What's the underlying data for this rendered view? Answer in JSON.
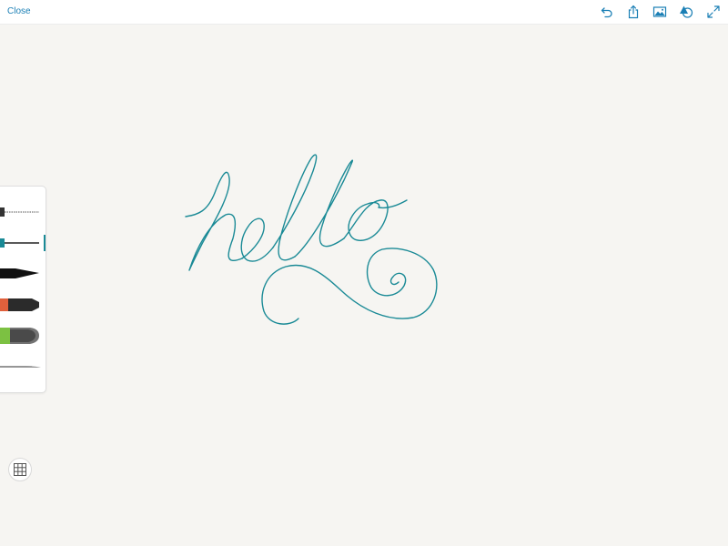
{
  "topbar": {
    "close_label": "Close",
    "tools": [
      {
        "icon": "undo-icon"
      },
      {
        "icon": "share-icon"
      },
      {
        "icon": "image-icon"
      },
      {
        "icon": "layers-icon"
      },
      {
        "icon": "fullscreen-icon"
      }
    ]
  },
  "canvas": {
    "ink_color": "#1a8a96",
    "drawing_text": "hello"
  },
  "brush_panel": {
    "brushes": [
      {
        "name": "fine-pen"
      },
      {
        "name": "line-pen",
        "selected": true
      },
      {
        "name": "calligraphy-pen"
      },
      {
        "name": "marker",
        "color": "#e0603c"
      },
      {
        "name": "watercolor",
        "color": "#7cc142"
      },
      {
        "name": "airbrush"
      }
    ]
  },
  "grid_toggle": {
    "icon": "grid-icon"
  },
  "colors": {
    "accent": "#1a7fb5",
    "ink": "#1a8a96",
    "background": "#f6f5f2"
  }
}
